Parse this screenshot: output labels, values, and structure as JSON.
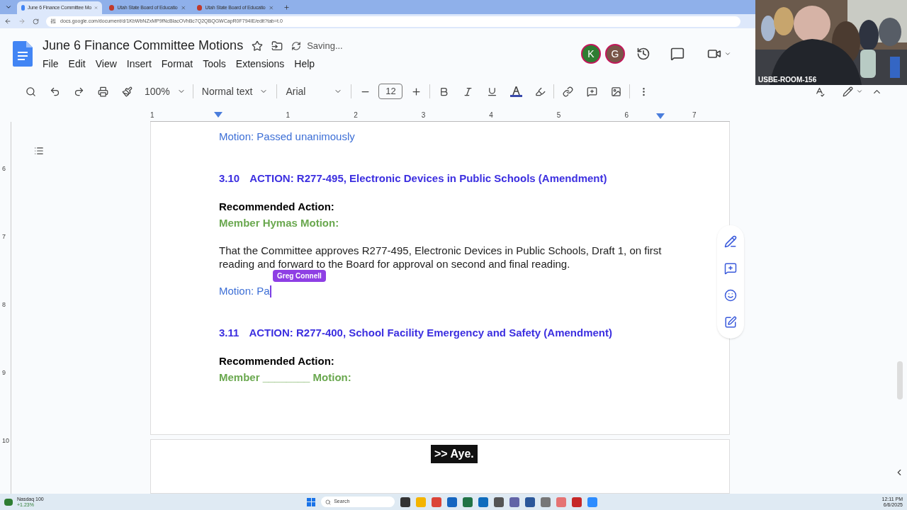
{
  "browser": {
    "tabs": [
      {
        "label": "June 6 Finance Committee Mo",
        "selected": true
      },
      {
        "label": "Utah State Board of Educatio",
        "selected": false
      },
      {
        "label": "Utah State Board of Educatio",
        "selected": false
      }
    ],
    "url": "docs.google.com/document/d/1KbWbNZxMP9fNcBlacOVhBc7Q2QBQGWCapR0F794IE/edit?tab=t.0"
  },
  "doc": {
    "title": "June 6 Finance Committee Motions",
    "status": "Saving...",
    "menu": [
      "File",
      "Edit",
      "View",
      "Insert",
      "Format",
      "Tools",
      "Extensions",
      "Help"
    ],
    "collaborators": [
      {
        "initial": "K",
        "color": "#2e7d32"
      },
      {
        "initial": "G",
        "color": "#795548"
      }
    ]
  },
  "toolbar": {
    "zoom": "100%",
    "style": "Normal text",
    "font": "Arial",
    "size": "12"
  },
  "ruler": [
    "1",
    "1",
    "2",
    "3",
    "4",
    "5",
    "6",
    "7"
  ],
  "vertical_ruler": [
    "6",
    "7",
    "8",
    "9",
    "10"
  ],
  "paragraphs": [
    {
      "kind": "motion",
      "text": "Motion: Passed unanimously"
    },
    {
      "kind": "heading",
      "number": "3.10",
      "text": "ACTION: R277-495, Electronic Devices in Public Schools (Amendment)"
    },
    {
      "kind": "label",
      "text": "Recommended Action:"
    },
    {
      "kind": "member",
      "text": "Member Hymas Motion:"
    },
    {
      "kind": "body",
      "text": "That the Committee approves R277-495, Electronic Devices in Public Schools, Draft 1, on first reading and forward to the Board for approval on second and final reading."
    },
    {
      "kind": "motion",
      "text": "Motion: Pa",
      "cursor": "Greg Connell"
    },
    {
      "kind": "heading",
      "number": "3.11",
      "text": "ACTION: R277-400, School Facility Emergency and Safety (Amendment)"
    },
    {
      "kind": "label",
      "text": "Recommended Action:"
    },
    {
      "kind": "member",
      "text": "Member ________ Motion:"
    }
  ],
  "video": {
    "caption": "USBE-ROOM-156"
  },
  "subtitle": ">> Aye.",
  "taskbar": {
    "widget": "Nasdaq 100",
    "widget_change": "+1.23%",
    "search": "Search",
    "time": "12:11 PM",
    "date": "6/6/2025"
  }
}
